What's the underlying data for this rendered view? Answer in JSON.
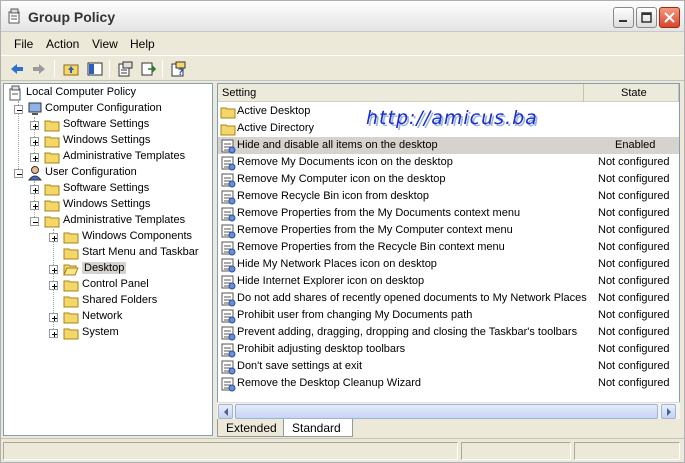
{
  "window": {
    "title": "Group Policy",
    "icon": "group-policy-icon"
  },
  "menu": [
    "File",
    "Action",
    "View",
    "Help"
  ],
  "toolbar": [
    "back-arrow-icon",
    "forward-arrow-icon",
    "up-folder-icon",
    "show-hide-tree-icon",
    "properties-icon",
    "export-list-icon",
    "help-icon"
  ],
  "tree": {
    "root": "Local Computer Policy",
    "computer": "Computer Configuration",
    "c_software": "Software Settings",
    "c_windows": "Windows Settings",
    "c_admin": "Administrative Templates",
    "user": "User Configuration",
    "u_software": "Software Settings",
    "u_windows": "Windows Settings",
    "u_admin": "Administrative Templates",
    "wincomp": "Windows Components",
    "startmenu": "Start Menu and Taskbar",
    "desktop": "Desktop",
    "controlpanel": "Control Panel",
    "shared": "Shared Folders",
    "network": "Network",
    "system": "System"
  },
  "list": {
    "col_setting": "Setting",
    "col_state": "State",
    "folders": [
      "Active Desktop",
      "Active Directory"
    ],
    "rows": [
      {
        "name": "Hide and disable all items on the desktop",
        "state": "Enabled"
      },
      {
        "name": "Remove My Documents icon on the desktop",
        "state": "Not configured"
      },
      {
        "name": "Remove My Computer icon on the desktop",
        "state": "Not configured"
      },
      {
        "name": "Remove Recycle Bin icon from desktop",
        "state": "Not configured"
      },
      {
        "name": "Remove Properties from the My Documents context menu",
        "state": "Not configured"
      },
      {
        "name": "Remove Properties from the My Computer context menu",
        "state": "Not configured"
      },
      {
        "name": "Remove Properties from the Recycle Bin context menu",
        "state": "Not configured"
      },
      {
        "name": "Hide My Network Places icon on desktop",
        "state": "Not configured"
      },
      {
        "name": "Hide Internet Explorer icon on desktop",
        "state": "Not configured"
      },
      {
        "name": "Do not add shares of recently opened documents to My Network Places",
        "state": "Not configured"
      },
      {
        "name": "Prohibit user from changing My Documents path",
        "state": "Not configured"
      },
      {
        "name": "Prevent adding, dragging, dropping and closing the Taskbar's toolbars",
        "state": "Not configured"
      },
      {
        "name": "Prohibit adjusting desktop toolbars",
        "state": "Not configured"
      },
      {
        "name": "Don't save settings at exit",
        "state": "Not configured"
      },
      {
        "name": "Remove the Desktop Cleanup Wizard",
        "state": "Not configured"
      }
    ]
  },
  "watermark": "http://amicus.ba",
  "tabs": [
    "Extended",
    "Standard"
  ],
  "colors": {
    "selection": "#d6d3ce",
    "folder": "#f5d769",
    "watermark": "#1a2fc7"
  }
}
